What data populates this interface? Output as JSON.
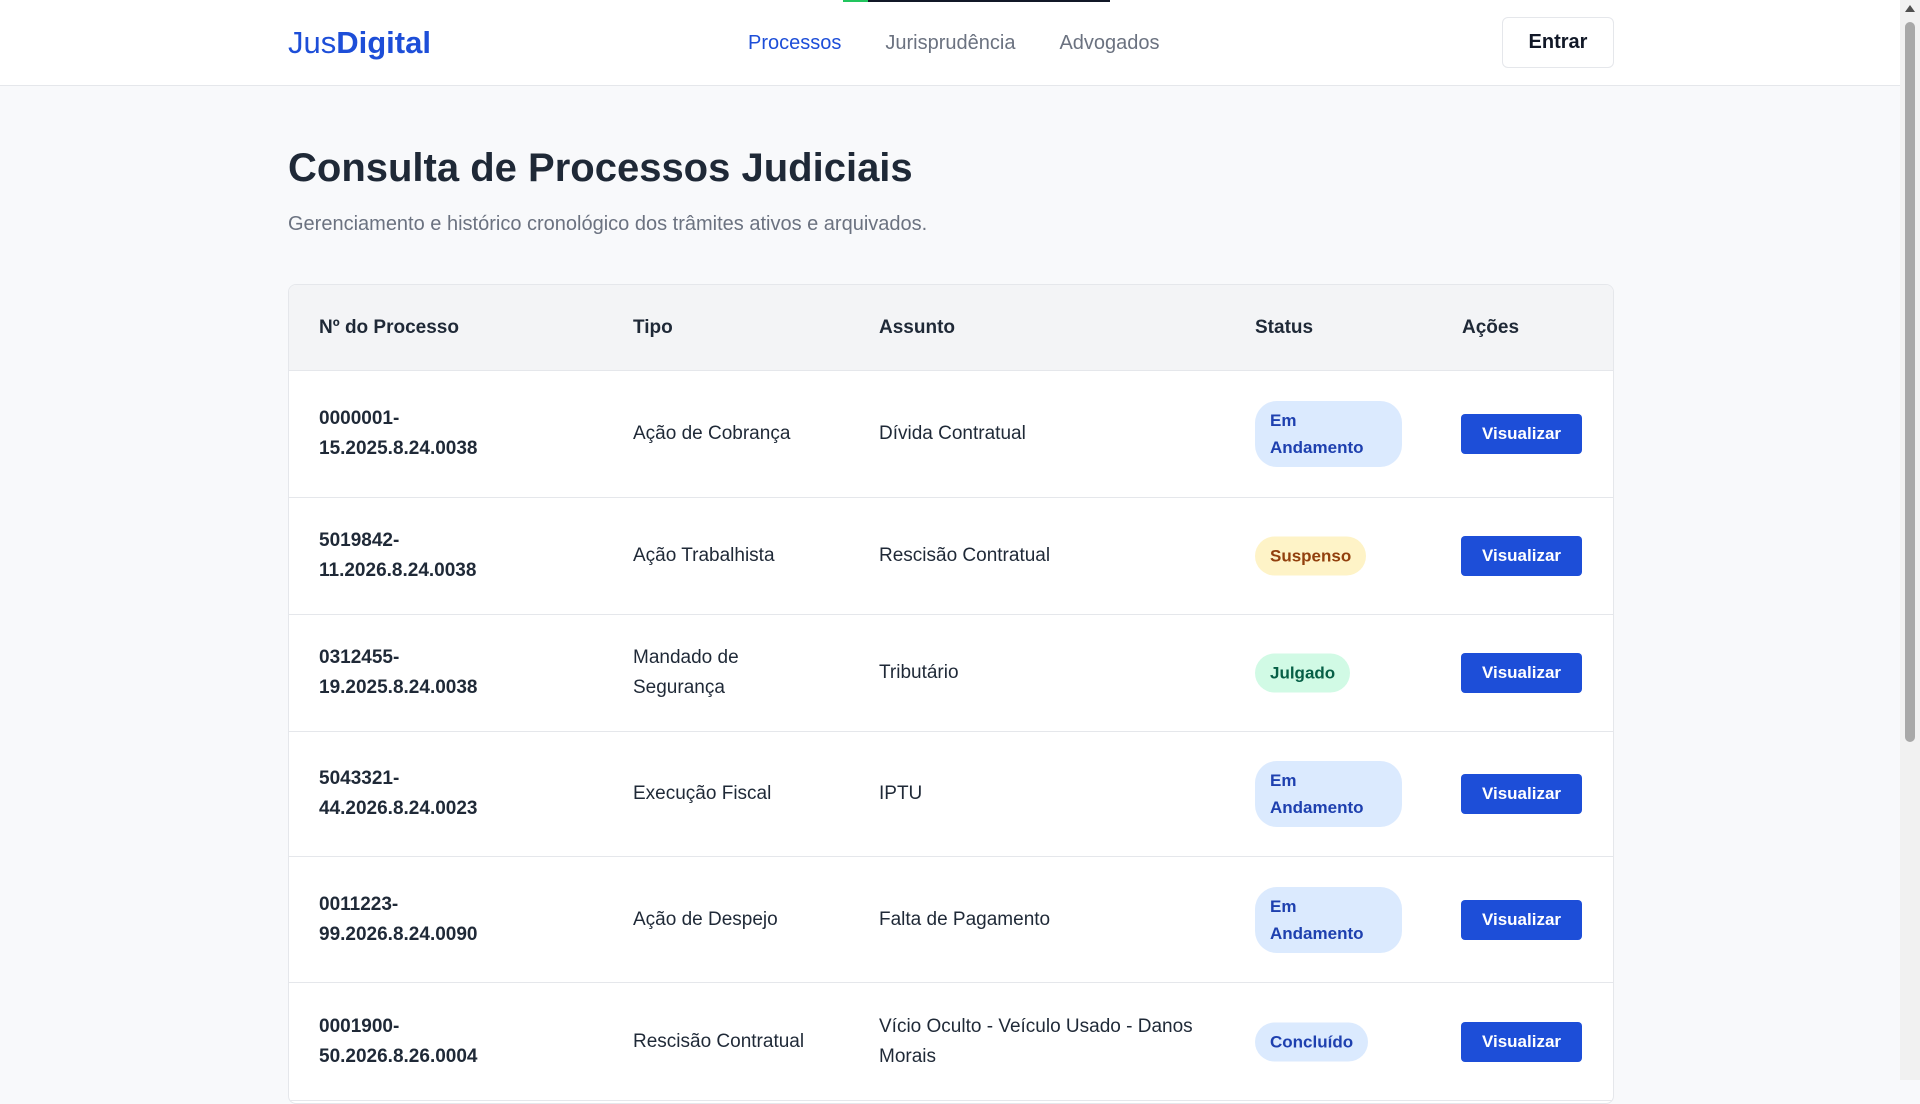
{
  "header": {
    "logo_prefix": "Jus",
    "logo_suffix": "Digital",
    "nav": [
      "Processos",
      "Jurisprudência",
      "Advogados"
    ],
    "active_nav": "Processos",
    "login_label": "Entrar"
  },
  "page": {
    "title": "Consulta de Processos Judiciais",
    "subtitle": "Gerenciamento e histórico cronológico dos trâmites ativos e arquivados."
  },
  "table": {
    "columns": [
      "Nº do Processo",
      "Tipo",
      "Assunto",
      "Status",
      "Ações"
    ],
    "rows": [
      {
        "numero": "0000001-15.2025.8.24.0038",
        "tipo": "Ação de Cobrança",
        "assunto": "Dívida Contratual",
        "status": "Em Andamento",
        "acao": "Visualizar"
      },
      {
        "numero": "5019842-11.2026.8.24.0038",
        "tipo": "Ação Trabalhista",
        "assunto": "Rescisão Contratual",
        "status": "Suspenso",
        "acao": "Visualizar"
      },
      {
        "numero": "0312455-19.2025.8.24.0038",
        "tipo": "Mandado de Segurança",
        "assunto": "Tributário",
        "status": "Julgado",
        "acao": "Visualizar"
      },
      {
        "numero": "5043321-44.2026.8.24.0023",
        "tipo": "Execução Fiscal",
        "assunto": "IPTU",
        "status": "Em Andamento",
        "acao": "Visualizar"
      },
      {
        "numero": "0011223-99.2026.8.24.0090",
        "tipo": "Ação de Despejo",
        "assunto": "Falta de Pagamento",
        "status": "Em Andamento",
        "acao": "Visualizar"
      },
      {
        "numero": "0001900-50.2026.8.26.0004",
        "tipo": "Rescisão Contratual",
        "assunto": "Vício Oculto - Veículo Usado - Danos Morais",
        "status": "Concluído",
        "acao": "Visualizar"
      }
    ]
  },
  "colors": {
    "brand": "#1d4ed8",
    "em_andamento": "#dbeafe",
    "suspenso": "#fef3c7",
    "julgado": "#d1fae5"
  }
}
